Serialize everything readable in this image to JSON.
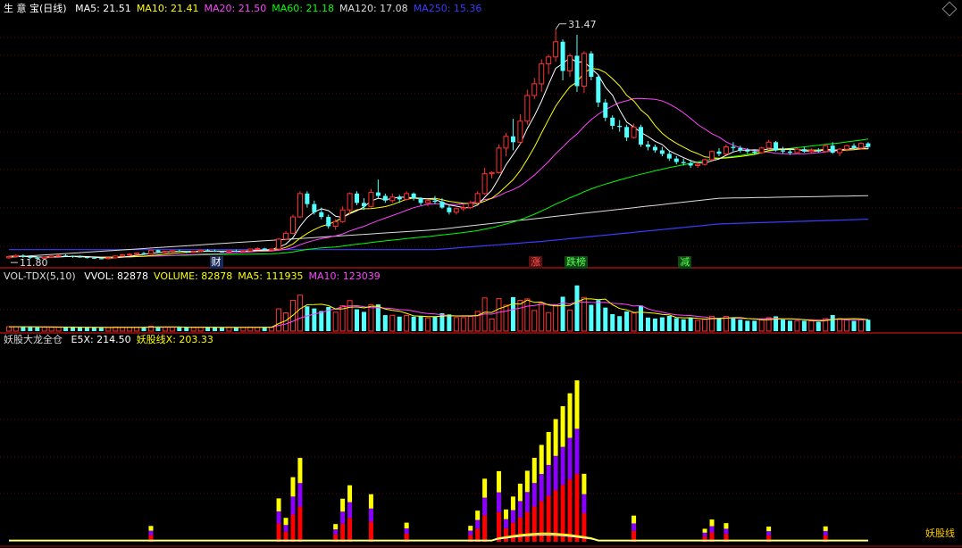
{
  "main_panel": {
    "stock_name": "生 意 宝",
    "period": "(日线)",
    "ma": [
      {
        "label": "MA5:",
        "value": "21.51",
        "color": "#ffffff"
      },
      {
        "label": "MA10:",
        "value": "21.41",
        "color": "#ffff00"
      },
      {
        "label": "MA20:",
        "value": "21.50",
        "color": "#ff44ff"
      },
      {
        "label": "MA60:",
        "value": "21.18",
        "color": "#00ff00"
      },
      {
        "label": "MA120:",
        "value": "17.08",
        "color": "#dddddd"
      },
      {
        "label": "MA250:",
        "value": "15.36",
        "color": "#3b3bff"
      }
    ],
    "high_label": "31.47",
    "low_label": "11.80",
    "tags": [
      {
        "text": "财",
        "color": "#ffffff",
        "bg": "#1a2a5a"
      },
      {
        "text": "涨",
        "color": "#ff5555",
        "bg": "#5a1010"
      },
      {
        "text": "跌榜",
        "color": "#55ff55",
        "bg": "#104a10"
      },
      {
        "text": "减",
        "color": "#55ff55",
        "bg": "#104a10"
      }
    ]
  },
  "volume_panel": {
    "name": "VOL-TDX(5,10)",
    "items": [
      {
        "label": "VVOL:",
        "value": "82878",
        "color": "#ffffff"
      },
      {
        "label": "VOLUME:",
        "value": "82878",
        "color": "#ffff00"
      },
      {
        "label": "MA5:",
        "value": "111935",
        "color": "#ffff00"
      },
      {
        "label": "MA10:",
        "value": "123039",
        "color": "#ff44ff"
      }
    ]
  },
  "indicator_panel": {
    "name": "妖股大龙全仓",
    "items": [
      {
        "label": "E5X:",
        "value": "214.50",
        "color": "#ffffff"
      },
      {
        "label": "妖股线X:",
        "value": "203.33",
        "color": "#ffff00"
      }
    ],
    "line_label": "妖股线"
  },
  "chart_data": {
    "type": "candlestick",
    "candles": [
      [
        11.9,
        12.1,
        11.8,
        12.0
      ],
      [
        12.0,
        12.2,
        11.9,
        12.1
      ],
      [
        12.1,
        12.2,
        11.9,
        12.0
      ],
      [
        12.0,
        12.1,
        11.8,
        11.9
      ],
      [
        11.9,
        12.0,
        11.8,
        11.85
      ],
      [
        11.85,
        12.0,
        11.8,
        11.95
      ],
      [
        11.95,
        12.1,
        11.9,
        12.05
      ],
      [
        12.05,
        12.2,
        12.0,
        12.1
      ],
      [
        12.1,
        12.2,
        12.0,
        12.05
      ],
      [
        12.05,
        12.1,
        11.9,
        12.0
      ],
      [
        12.0,
        12.1,
        11.9,
        11.95
      ],
      [
        11.95,
        12.0,
        11.85,
        11.9
      ],
      [
        11.9,
        12.0,
        11.8,
        11.85
      ],
      [
        11.85,
        11.9,
        11.8,
        11.82
      ],
      [
        11.82,
        11.95,
        11.8,
        11.9
      ],
      [
        11.9,
        12.1,
        11.85,
        12.05
      ],
      [
        12.05,
        12.2,
        12.0,
        12.15
      ],
      [
        12.15,
        12.3,
        12.1,
        12.2
      ],
      [
        12.2,
        12.35,
        12.15,
        12.3
      ],
      [
        12.3,
        12.4,
        12.2,
        12.25
      ],
      [
        12.25,
        12.6,
        12.2,
        12.55
      ],
      [
        12.55,
        12.6,
        12.3,
        12.4
      ],
      [
        12.4,
        12.5,
        12.3,
        12.45
      ],
      [
        12.45,
        12.55,
        12.35,
        12.5
      ],
      [
        12.5,
        12.6,
        12.4,
        12.45
      ],
      [
        12.45,
        12.5,
        12.3,
        12.4
      ],
      [
        12.4,
        12.5,
        12.35,
        12.45
      ],
      [
        12.45,
        12.6,
        12.4,
        12.55
      ],
      [
        12.55,
        12.65,
        12.45,
        12.5
      ],
      [
        12.5,
        12.6,
        12.4,
        12.45
      ],
      [
        12.45,
        12.5,
        12.35,
        12.4
      ],
      [
        12.4,
        12.55,
        12.35,
        12.5
      ],
      [
        12.5,
        12.6,
        12.4,
        12.45
      ],
      [
        12.45,
        12.55,
        12.4,
        12.5
      ],
      [
        12.5,
        12.7,
        12.45,
        12.65
      ],
      [
        12.65,
        12.8,
        12.6,
        12.7
      ],
      [
        12.7,
        12.75,
        12.5,
        12.55
      ],
      [
        12.55,
        12.7,
        12.5,
        12.65
      ],
      [
        12.65,
        13.6,
        12.6,
        13.5
      ],
      [
        13.5,
        14.2,
        13.4,
        14.0
      ],
      [
        14.0,
        15.6,
        13.9,
        15.4
      ],
      [
        15.4,
        17.6,
        15.3,
        17.4
      ],
      [
        17.4,
        17.6,
        16.2,
        16.5
      ],
      [
        16.5,
        16.8,
        15.6,
        15.8
      ],
      [
        15.8,
        16.2,
        15.2,
        15.4
      ],
      [
        15.4,
        15.6,
        14.4,
        14.6
      ],
      [
        14.6,
        15.2,
        14.3,
        15.0
      ],
      [
        15.0,
        16.3,
        14.9,
        16.0
      ],
      [
        16.0,
        17.5,
        15.6,
        17.4
      ],
      [
        17.4,
        17.6,
        16.4,
        16.6
      ],
      [
        16.6,
        17.0,
        16.0,
        16.3
      ],
      [
        16.3,
        17.8,
        16.2,
        17.5
      ],
      [
        17.5,
        18.6,
        17.0,
        17.2
      ],
      [
        17.2,
        17.4,
        16.6,
        16.8
      ],
      [
        16.8,
        17.4,
        16.6,
        17.1
      ],
      [
        17.1,
        17.3,
        16.6,
        16.9
      ],
      [
        16.9,
        17.6,
        16.8,
        17.4
      ],
      [
        17.4,
        17.5,
        16.8,
        17.0
      ],
      [
        17.0,
        17.1,
        16.4,
        16.6
      ],
      [
        16.6,
        16.9,
        16.3,
        16.8
      ],
      [
        16.8,
        17.2,
        16.5,
        16.7
      ],
      [
        16.7,
        17.0,
        16.1,
        16.2
      ],
      [
        16.2,
        16.4,
        15.6,
        15.8
      ],
      [
        15.8,
        16.2,
        15.6,
        16.1
      ],
      [
        16.1,
        16.5,
        15.9,
        16.2
      ],
      [
        16.2,
        16.8,
        16.1,
        16.6
      ],
      [
        16.6,
        17.6,
        16.5,
        17.4
      ],
      [
        17.4,
        19.6,
        17.3,
        19.1
      ],
      [
        19.1,
        19.3,
        18.7,
        19.2
      ],
      [
        19.2,
        21.6,
        19.1,
        21.3
      ],
      [
        21.3,
        22.6,
        20.6,
        22.3
      ],
      [
        22.3,
        23.8,
        21.1,
        21.8
      ],
      [
        21.8,
        24.2,
        21.6,
        23.6
      ],
      [
        23.6,
        26.3,
        23.3,
        25.8
      ],
      [
        25.8,
        27.3,
        25.5,
        26.8
      ],
      [
        26.8,
        28.9,
        26.1,
        28.5
      ],
      [
        28.5,
        29.3,
        27.6,
        29.1
      ],
      [
        29.1,
        31.47,
        28.7,
        30.4
      ],
      [
        30.4,
        30.6,
        27.1,
        27.9
      ],
      [
        27.9,
        29.4,
        27.4,
        29.2
      ],
      [
        29.2,
        31.0,
        26.1,
        26.6
      ],
      [
        26.6,
        29.6,
        26.0,
        29.4
      ],
      [
        29.4,
        29.6,
        27.1,
        27.4
      ],
      [
        27.4,
        27.6,
        24.8,
        25.2
      ],
      [
        25.2,
        25.5,
        23.6,
        23.9
      ],
      [
        23.9,
        24.1,
        22.9,
        23.2
      ],
      [
        23.2,
        23.7,
        22.7,
        23.1
      ],
      [
        23.1,
        23.3,
        21.9,
        22.2
      ],
      [
        22.2,
        23.4,
        22.1,
        23.1
      ],
      [
        23.1,
        23.3,
        21.4,
        21.6
      ],
      [
        21.6,
        21.9,
        21.1,
        21.4
      ],
      [
        21.4,
        21.6,
        20.9,
        21.1
      ],
      [
        21.1,
        21.4,
        20.6,
        20.8
      ],
      [
        20.8,
        21.1,
        20.2,
        20.4
      ],
      [
        20.4,
        20.6,
        19.9,
        20.1
      ],
      [
        20.1,
        20.4,
        19.8,
        20.0
      ],
      [
        20.0,
        20.3,
        19.6,
        19.8
      ],
      [
        19.8,
        20.1,
        19.6,
        19.9
      ],
      [
        19.9,
        20.4,
        19.8,
        20.3
      ],
      [
        20.3,
        21.1,
        20.2,
        21.0
      ],
      [
        21.0,
        21.3,
        20.6,
        20.8
      ],
      [
        20.8,
        21.6,
        20.7,
        21.4
      ],
      [
        21.4,
        21.8,
        21.0,
        21.3
      ],
      [
        21.3,
        21.5,
        20.9,
        21.1
      ],
      [
        21.1,
        21.3,
        20.8,
        21.0
      ],
      [
        21.0,
        21.2,
        20.7,
        20.9
      ],
      [
        20.9,
        21.4,
        20.8,
        21.3
      ],
      [
        21.3,
        22.0,
        21.2,
        21.8
      ],
      [
        21.8,
        21.9,
        21.0,
        21.1
      ],
      [
        21.1,
        21.4,
        20.8,
        21.0
      ],
      [
        21.0,
        21.2,
        20.7,
        20.9
      ],
      [
        20.9,
        21.3,
        20.8,
        21.2
      ],
      [
        21.2,
        21.4,
        20.9,
        21.0
      ],
      [
        21.0,
        21.3,
        20.8,
        21.1
      ],
      [
        21.1,
        21.3,
        20.9,
        21.0
      ],
      [
        21.0,
        21.6,
        20.9,
        21.5
      ],
      [
        21.5,
        21.8,
        20.8,
        20.9
      ],
      [
        20.9,
        21.3,
        20.6,
        21.2
      ],
      [
        21.2,
        21.6,
        21.0,
        21.5
      ],
      [
        21.5,
        21.7,
        21.2,
        21.3
      ],
      [
        21.3,
        21.8,
        21.2,
        21.7
      ],
      [
        21.7,
        21.8,
        21.2,
        21.4
      ]
    ],
    "ma_lines": {
      "MA120": [
        [
          0,
          11.95
        ],
        [
          60,
          14.3
        ],
        [
          100,
          17.0
        ],
        [
          129,
          17.3
        ]
      ],
      "MA250": [
        [
          0,
          12.6
        ],
        [
          60,
          12.6
        ],
        [
          75,
          13.3
        ],
        [
          100,
          14.8
        ],
        [
          129,
          15.36
        ]
      ]
    },
    "ylim": [
      11.2,
      32.6
    ],
    "volume_ylim": [
      0,
      300000
    ],
    "indicator_ylim": [
      0,
      1800
    ],
    "tag_positions": [
      29,
      74,
      79,
      95
    ]
  }
}
